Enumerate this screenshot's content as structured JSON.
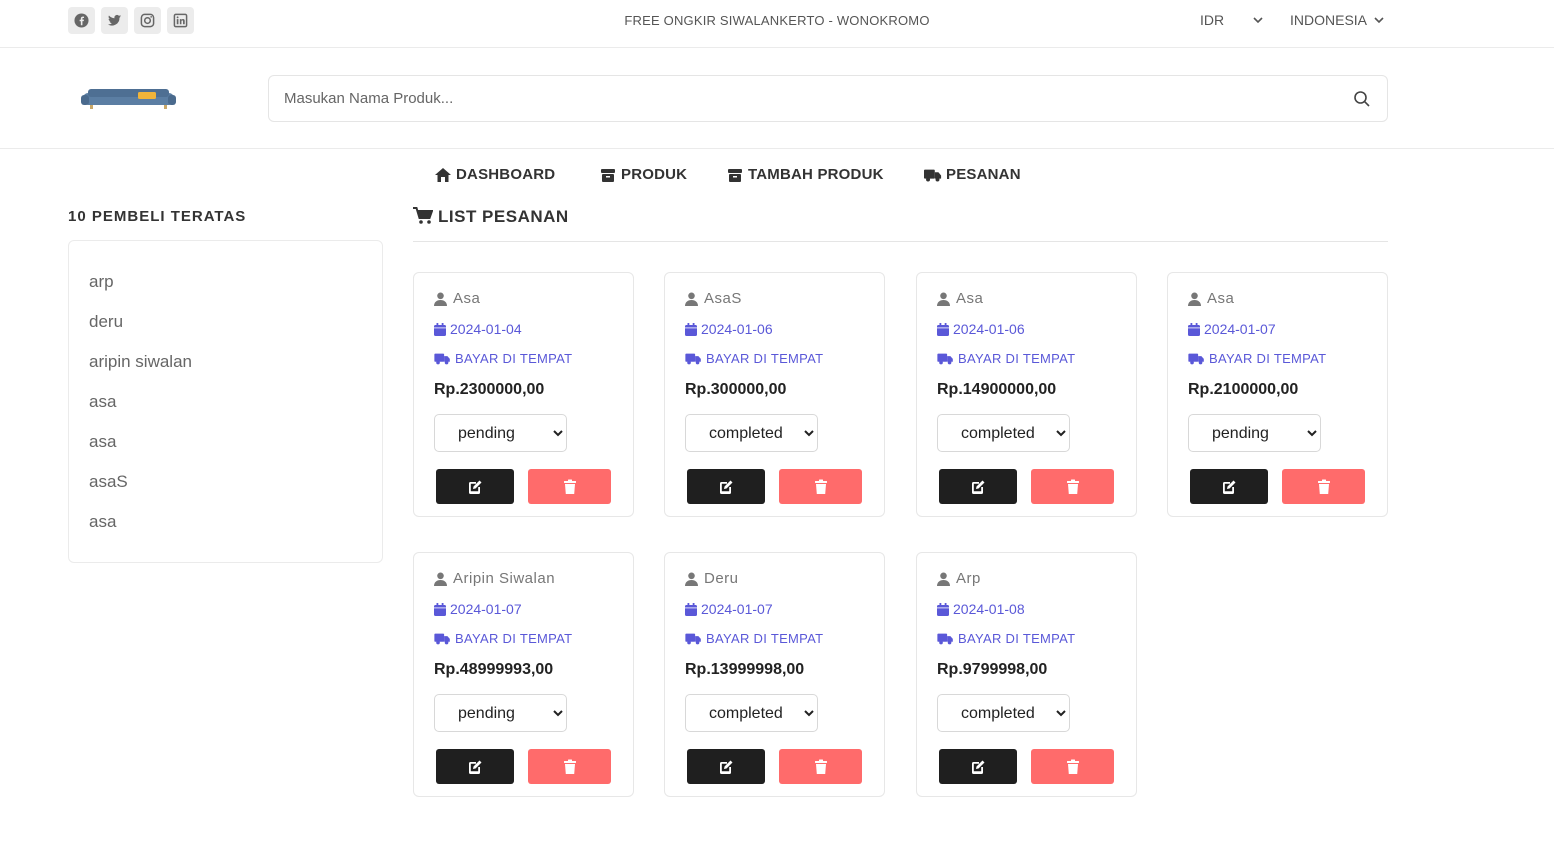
{
  "topbar": {
    "socials": [
      "facebook-icon",
      "twitter-icon",
      "instagram-icon",
      "linkedin-icon"
    ],
    "promo": "FREE ONGKIR SIWALANKERTO - WONOKROMO",
    "currency": "IDR",
    "language": "INDONESIA"
  },
  "search": {
    "placeholder": "Masukan Nama Produk..."
  },
  "nav": {
    "dashboard": "DASHBOARD",
    "produk": "PRODUK",
    "tambah_produk": "TAMBAH PRODUK",
    "pesanan": "PESANAN"
  },
  "sidebar": {
    "title": "10 PEMBELI TERATAS",
    "buyers": [
      "arp",
      "deru",
      "aripin siwalan",
      "asa",
      "asa",
      "asaS",
      "asa"
    ]
  },
  "main": {
    "title": "LIST PESANAN",
    "orders": [
      {
        "name": "Asa",
        "date": "2024-01-04",
        "payment": "BAYAR DI TEMPAT",
        "price": "Rp.2300000,00",
        "status": "pending"
      },
      {
        "name": "AsaS",
        "date": "2024-01-06",
        "payment": "BAYAR DI TEMPAT",
        "price": "Rp.300000,00",
        "status": "completed"
      },
      {
        "name": "Asa",
        "date": "2024-01-06",
        "payment": "BAYAR DI TEMPAT",
        "price": "Rp.14900000,00",
        "status": "completed"
      },
      {
        "name": "Asa",
        "date": "2024-01-07",
        "payment": "BAYAR DI TEMPAT",
        "price": "Rp.2100000,00",
        "status": "pending"
      },
      {
        "name": "Aripin Siwalan",
        "date": "2024-01-07",
        "payment": "BAYAR DI TEMPAT",
        "price": "Rp.48999993,00",
        "status": "pending"
      },
      {
        "name": "Deru",
        "date": "2024-01-07",
        "payment": "BAYAR DI TEMPAT",
        "price": "Rp.13999998,00",
        "status": "completed"
      },
      {
        "name": "Arp",
        "date": "2024-01-08",
        "payment": "BAYAR DI TEMPAT",
        "price": "Rp.9799998,00",
        "status": "completed"
      }
    ]
  },
  "colors": {
    "accent": "#5a58d8",
    "edit_button": "#1f1f1f",
    "delete_button": "#ff6b6b"
  }
}
